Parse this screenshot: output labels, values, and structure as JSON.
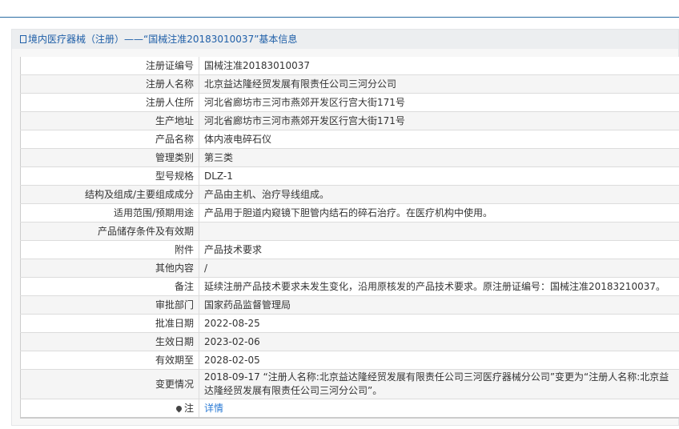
{
  "header": {
    "title": "境内医疗器械（注册）——“国械注准20183010037”基本信息"
  },
  "rows": [
    {
      "label": "注册证编号",
      "value": "国械注准20183010037"
    },
    {
      "label": "注册人名称",
      "value": "北京益达隆经贸发展有限责任公司三河分公司"
    },
    {
      "label": "注册人住所",
      "value": "河北省廊坊市三河市燕郊开发区行宫大街171号"
    },
    {
      "label": "生产地址",
      "value": "河北省廊坊市三河市燕郊开发区行宫大街171号"
    },
    {
      "label": "产品名称",
      "value": "体内液电碎石仪"
    },
    {
      "label": "管理类别",
      "value": "第三类"
    },
    {
      "label": "型号规格",
      "value": "DLZ-1"
    },
    {
      "label": "结构及组成/主要组成成分",
      "value": "产品由主机、治疗导线组成。"
    },
    {
      "label": "适用范围/预期用途",
      "value": "产品用于胆道内窥镜下胆管内结石的碎石治疗。在医疗机构中使用。"
    },
    {
      "label": "产品储存条件及有效期",
      "value": ""
    },
    {
      "label": "附件",
      "value": "产品技术要求"
    },
    {
      "label": "其他内容",
      "value": "/"
    },
    {
      "label": "备注",
      "value": "延续注册产品技术要求未发生变化，沿用原核发的产品技术要求。原注册证编号：国械注准20183210037。"
    },
    {
      "label": "审批部门",
      "value": "国家药品监督管理局"
    },
    {
      "label": "批准日期",
      "value": "2022-08-25"
    },
    {
      "label": "生效日期",
      "value": "2023-02-06"
    },
    {
      "label": "有效期至",
      "value": "2028-02-05"
    },
    {
      "label": "变更情况",
      "value": "2018-09-17 “注册人名称:北京益达隆经贸发展有限责任公司三河医疗器械分公司”变更为“注册人名称:北京益达隆经贸发展有限责任公司三河分公司”。"
    }
  ],
  "note": {
    "label": "注",
    "link": "详情"
  }
}
